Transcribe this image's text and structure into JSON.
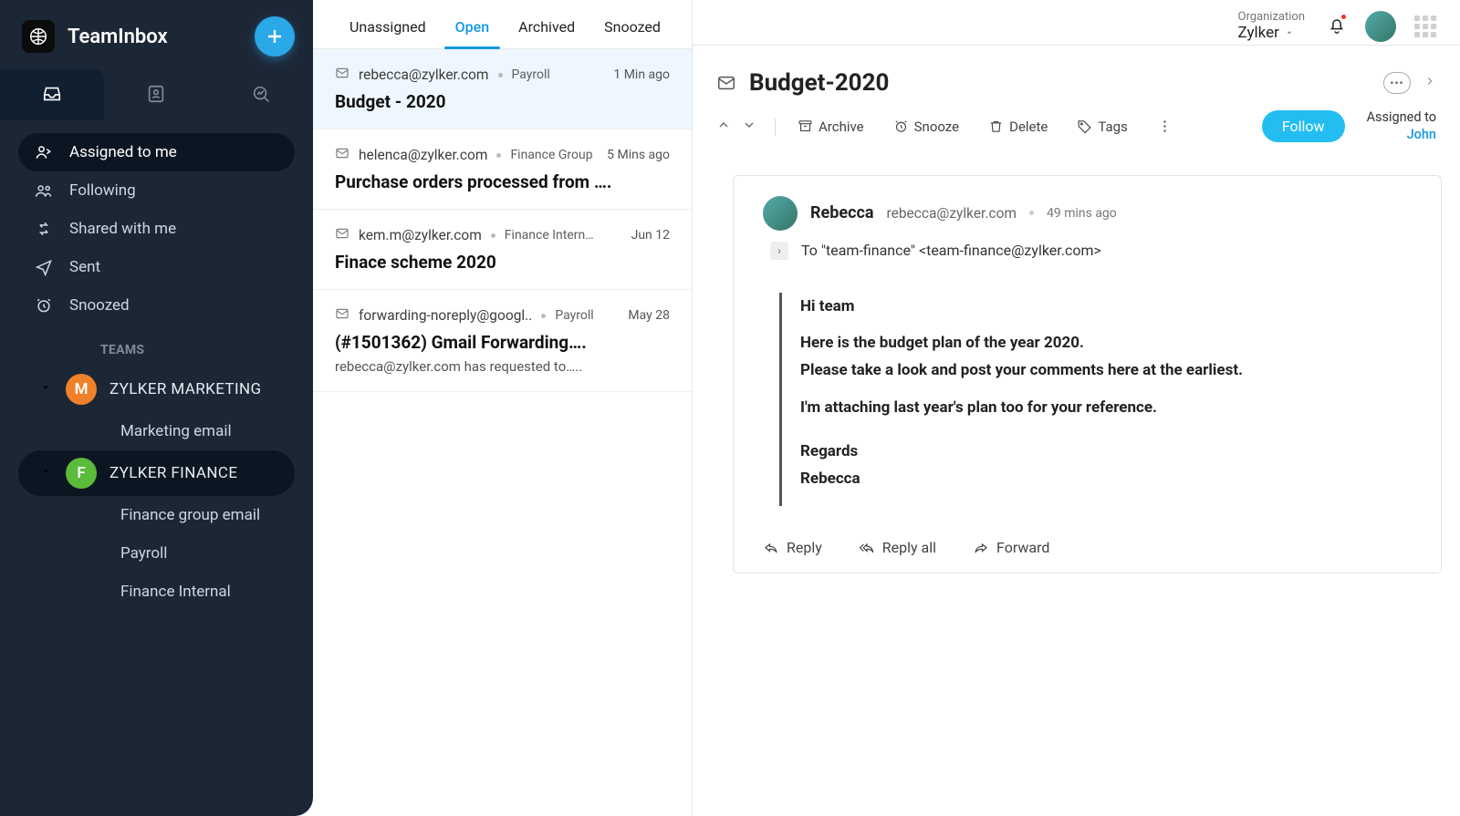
{
  "app": {
    "title": "TeamInbox"
  },
  "sidebar": {
    "nav": [
      {
        "label": "Assigned to me"
      },
      {
        "label": "Following"
      },
      {
        "label": "Shared with me"
      },
      {
        "label": "Sent"
      },
      {
        "label": "Snoozed"
      }
    ],
    "section_heading": "TEAMS",
    "teams": [
      {
        "initial": "M",
        "color": "#f0812a",
        "name": "ZYLKER MARKETING",
        "active": false,
        "subs": [
          "Marketing email"
        ]
      },
      {
        "initial": "F",
        "color": "#5bbb3a",
        "name": "ZYLKER FINANCE",
        "active": true,
        "subs": [
          "Finance group email",
          "Payroll",
          "Finance Internal"
        ]
      }
    ]
  },
  "tabs": [
    "Unassigned",
    "Open",
    "Archived",
    "Snoozed"
  ],
  "active_tab": "Open",
  "messages": [
    {
      "from": "rebecca@zylker.com",
      "tag": "Payroll",
      "time": "1 Min ago",
      "subject": "Budget - 2020",
      "preview": "",
      "selected": true
    },
    {
      "from": "helenca@zylker.com",
      "tag": "Finance Group",
      "time": "5 Mins ago",
      "subject": "Purchase orders processed from ….",
      "preview": ""
    },
    {
      "from": "kem.m@zylker.com",
      "tag": "Finance Intern…",
      "time": "Jun 12",
      "subject": "Finace scheme 2020",
      "preview": ""
    },
    {
      "from": "forwarding-noreply@googl..",
      "tag": "Payroll",
      "time": "May 28",
      "subject": "(#1501362) Gmail Forwarding….",
      "preview": "rebecca@zylker.com has requested to….."
    }
  ],
  "header": {
    "org_label": "Organization",
    "org_name": "Zylker"
  },
  "reader": {
    "subject": "Budget-2020",
    "toolbar": {
      "archive": "Archive",
      "snooze": "Snooze",
      "delete": "Delete",
      "tags": "Tags"
    },
    "follow_label": "Follow",
    "assigned_label": "Assigned to",
    "assigned_to": "John",
    "mail": {
      "sender_name": "Rebecca",
      "sender_email": "rebecca@zylker.com",
      "time": "49 mins ago",
      "to_line": "To \"team-finance\" <team-finance@zylker.com>",
      "greeting": "Hi team",
      "p1": "Here is the budget plan of the year 2020.",
      "p2": "Please take a look and post your comments here at the earliest.",
      "p3": "I'm attaching last year's plan too for your reference.",
      "sig1": "Regards",
      "sig2": "Rebecca"
    },
    "actions": {
      "reply": "Reply",
      "reply_all": "Reply all",
      "forward": "Forward"
    }
  }
}
